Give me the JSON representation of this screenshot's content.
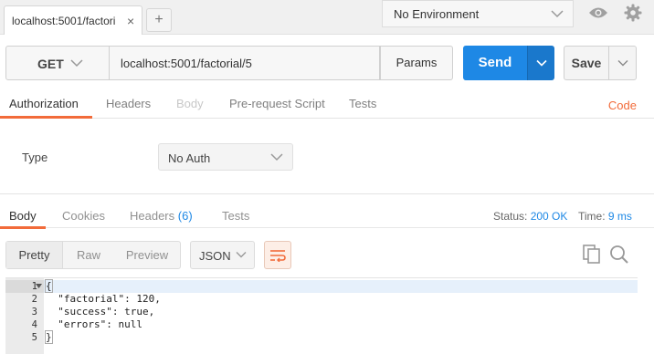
{
  "tab": {
    "title": "localhost:5001/factori",
    "close": "×",
    "new_tab": "+"
  },
  "environment": {
    "selected": "No Environment"
  },
  "request": {
    "method": "GET",
    "url": "localhost:5001/factorial/5",
    "params_label": "Params",
    "send_label": "Send",
    "save_label": "Save"
  },
  "request_tabs": {
    "authorization": "Authorization",
    "headers": "Headers",
    "body": "Body",
    "prerequest": "Pre-request Script",
    "tests": "Tests",
    "code": "Code"
  },
  "auth": {
    "type_label": "Type",
    "selected": "No Auth"
  },
  "response_tabs": {
    "body": "Body",
    "cookies": "Cookies",
    "headers": "Headers",
    "headers_count": "(6)",
    "tests": "Tests"
  },
  "response_meta": {
    "status_label": "Status:",
    "status_value": "200 OK",
    "time_label": "Time:",
    "time_value": "9 ms"
  },
  "view": {
    "pretty": "Pretty",
    "raw": "Raw",
    "preview": "Preview",
    "format": "JSON"
  },
  "code": {
    "line_numbers": [
      "1",
      "2",
      "3",
      "4",
      "5"
    ],
    "lines": [
      "{",
      "  \"factorial\": 120,",
      "  \"success\": true,",
      "  \"errors\": null",
      "}"
    ]
  },
  "colors": {
    "accent": "#f26b3a",
    "send_blue": "#1e88e5",
    "status_blue": "#1e88e5"
  }
}
